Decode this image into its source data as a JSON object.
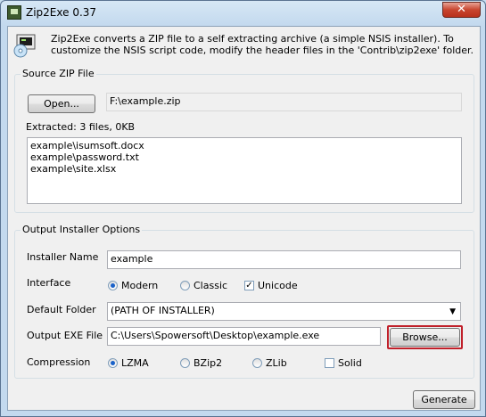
{
  "window": {
    "title": "Zip2Exe 0.37",
    "close_glyph": "✕"
  },
  "intro": "Zip2Exe converts a ZIP file to a self extracting archive (a simple NSIS installer). To customize the NSIS script code, modify the header files in the 'Contrib\\zip2exe' folder.",
  "source": {
    "group_title": "Source ZIP File",
    "open_label": "Open...",
    "zip_path": "F:\\example.zip",
    "extracted": "Extracted: 3 files, 0KB",
    "files": [
      "example\\isumsoft.docx",
      "example\\password.txt",
      "example\\site.xlsx"
    ]
  },
  "output": {
    "group_title": "Output Installer Options",
    "installer_name_label": "Installer Name",
    "installer_name": "example",
    "interface_label": "Interface",
    "modern_label": "Modern",
    "classic_label": "Classic",
    "unicode_label": "Unicode",
    "unicode_checked": true,
    "default_folder_label": "Default Folder",
    "default_folder": "(PATH OF INSTALLER)",
    "output_exe_label": "Output EXE File",
    "output_exe": "C:\\Users\\Spowersoft\\Desktop\\example.exe",
    "browse_label": "Browse...",
    "compression_label": "Compression",
    "lzma_label": "LZMA",
    "bzip2_label": "BZip2",
    "zlib_label": "ZLib",
    "solid_label": "Solid",
    "solid_checked": false
  },
  "generate_label": "Generate",
  "colors": {
    "highlight": "#c0202a",
    "radio_dot": "#1a62c9"
  }
}
